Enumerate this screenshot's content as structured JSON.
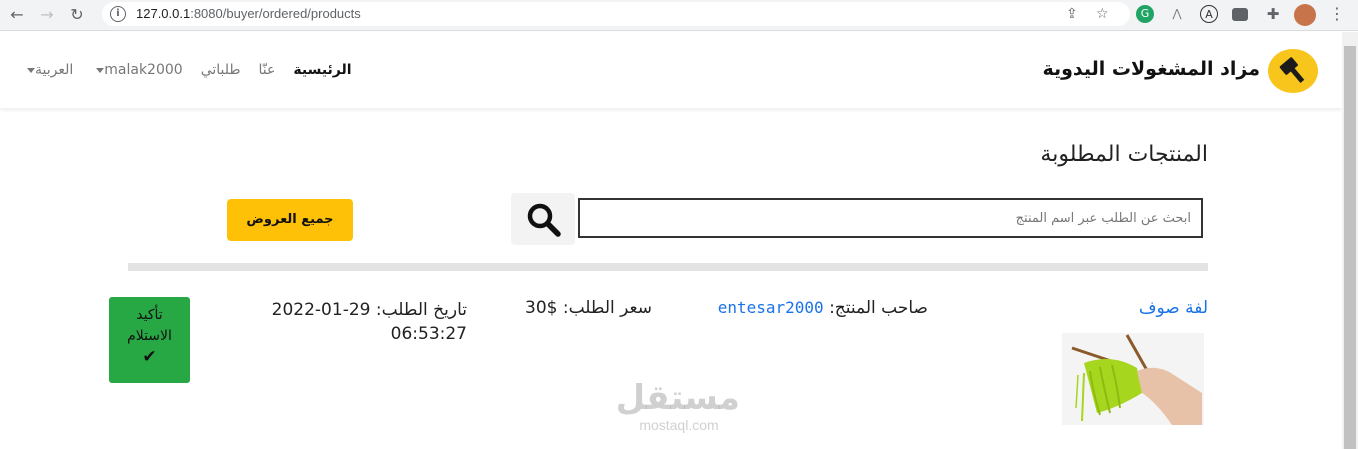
{
  "browser": {
    "url_host": "127.0.0.1",
    "url_rest": ":8080/buyer/ordered/products",
    "icons": [
      "back-icon",
      "forward-icon",
      "reload-icon",
      "info-icon",
      "share-icon",
      "bookmark-star-icon",
      "extension-icons",
      "puzzle-icon",
      "profile-avatar",
      "menu-dots-icon"
    ]
  },
  "navbar": {
    "brand": "مزاد المشغولات اليدوية",
    "links": {
      "home": "الرئيسية",
      "about": "عنّا",
      "orders": "طلباتي",
      "user": "malak2000",
      "language": "العربية"
    }
  },
  "main": {
    "title": "المنتجات المطلوبة",
    "search_placeholder": "ابحث عن الطلب عبر اسم المنتج",
    "all_offers": "جميع العروض"
  },
  "order": {
    "product_name": "لفة صوف",
    "owner_label": "صاحب المنتج: ",
    "owner_user": "entesar2000",
    "price_label": "سعر الطلب: ",
    "price": "$30",
    "date_label": "تاريخ الطلب: ",
    "date": "29-01-2022",
    "time": "06:53:27",
    "confirm_label_1": "تأكيد",
    "confirm_label_2": "الاستلام"
  },
  "watermark": {
    "arabic": "مستقل",
    "latin": "mostaql.com"
  },
  "colors": {
    "accent_yellow": "#ffc107",
    "link_blue": "#1a73e8",
    "success_green": "#28a745"
  }
}
